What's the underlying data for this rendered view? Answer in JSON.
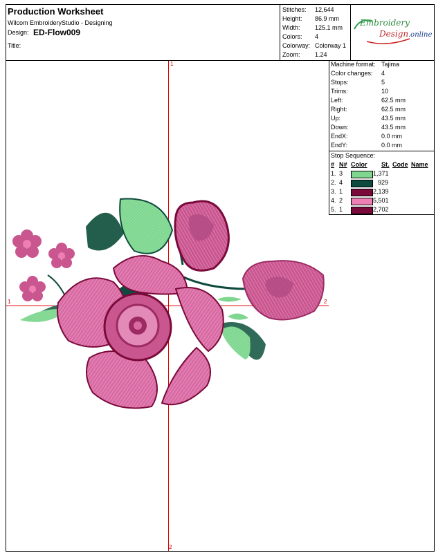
{
  "header": {
    "title": "Production Worksheet",
    "software": "Wilcom EmbroideryStudio - Designing",
    "design_label": "Design:",
    "design_name": "ED-Flow009",
    "title_label": "Title:"
  },
  "stats": [
    {
      "label": "Stitches:",
      "value": "12,644"
    },
    {
      "label": "Height:",
      "value": "86.9 mm"
    },
    {
      "label": "Width:",
      "value": "125.1 mm"
    },
    {
      "label": "Colors:",
      "value": "4"
    },
    {
      "label": "Colorway:",
      "value": "Colorway 1"
    },
    {
      "label": "Zoom:",
      "value": "1.24"
    }
  ],
  "logo": {
    "line1": "Embroidery",
    "line2": "Design",
    "line3": ".online"
  },
  "machine": [
    {
      "label": "Machine format:",
      "value": "Tajima"
    },
    {
      "label": "Color changes:",
      "value": "4"
    },
    {
      "label": "Stops:",
      "value": "5"
    },
    {
      "label": "Trims:",
      "value": "10"
    },
    {
      "label": "Left:",
      "value": "62.5 mm"
    },
    {
      "label": "Right:",
      "value": "62.5 mm"
    },
    {
      "label": "Up:",
      "value": "43.5 mm"
    },
    {
      "label": "Down:",
      "value": "43.5 mm"
    },
    {
      "label": "EndX:",
      "value": "0.0 mm"
    },
    {
      "label": "EndY:",
      "value": "0.0 mm"
    }
  ],
  "stop_sequence": {
    "title": "Stop Sequence:",
    "headers": {
      "idx": "#",
      "n": "N#",
      "color": "Color",
      "st": "St.",
      "code": "Code",
      "name": "Name"
    },
    "rows": [
      {
        "idx": "1.",
        "n": "3",
        "color": "#7ed68f",
        "st": "1,371"
      },
      {
        "idx": "2.",
        "n": "4",
        "color": "#0f4a3e",
        "st": "929"
      },
      {
        "idx": "3.",
        "n": "1",
        "color": "#7a0a3a",
        "st": "2,139"
      },
      {
        "idx": "4.",
        "n": "2",
        "color": "#ee7fb4",
        "st": "5,501"
      },
      {
        "idx": "5.",
        "n": "1",
        "color": "#7a0a3a",
        "st": "2,702"
      }
    ]
  },
  "axis_markers": {
    "top": "1",
    "left": "1",
    "right": "2",
    "bottom": "2"
  }
}
